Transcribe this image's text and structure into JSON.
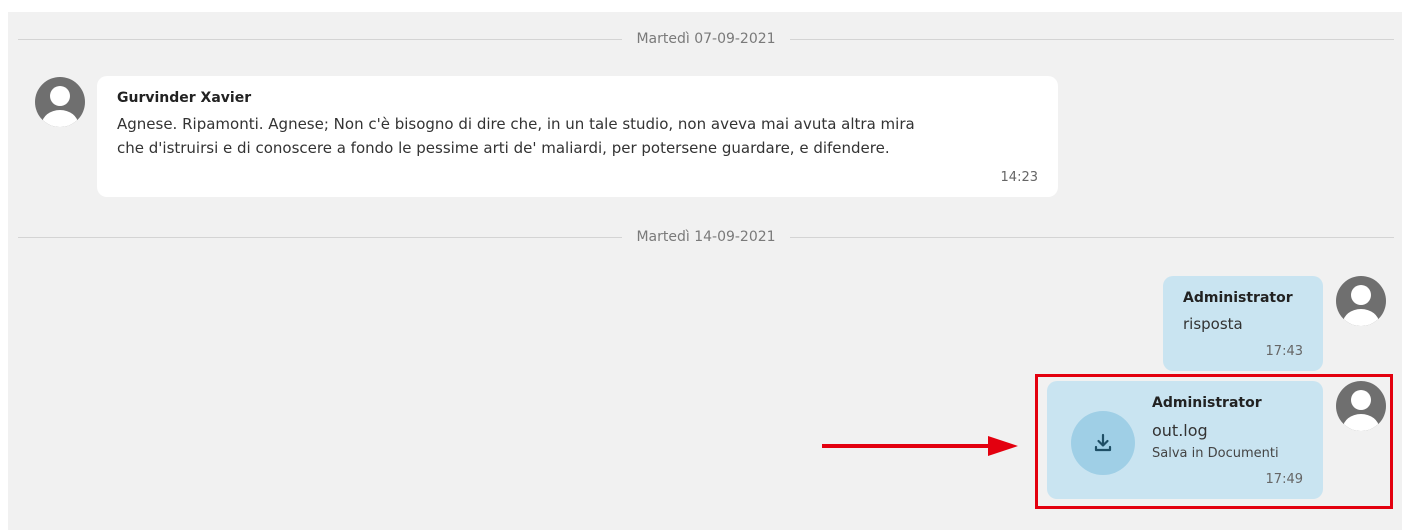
{
  "separators": [
    {
      "date": "Martedì 07-09-2021"
    },
    {
      "date": "Martedì 14-09-2021"
    }
  ],
  "messages": [
    {
      "sender": "Gurvinder Xavier",
      "text_line1": "Agnese. Ripamonti. Agnese; Non c'è bisogno di dire che, in un tale studio, non aveva mai avuta altra mira",
      "text_line2": "che d'istruirsi e di conoscere a fondo le pessime arti de' maliardi, per potersene guardare, e difendere.",
      "time": "14:23"
    },
    {
      "sender": "Administrator",
      "text": "risposta",
      "time": "17:43"
    },
    {
      "sender": "Administrator",
      "filename": "out.log",
      "save_label": "Salva in Documenti",
      "time": "17:49"
    }
  ],
  "icons": {
    "avatar": "user-avatar-icon",
    "download": "download-icon",
    "arrow": "arrow-right-annotation"
  },
  "colors": {
    "background": "#f1f1f1",
    "incoming_bubble": "#ffffff",
    "outgoing_bubble": "#c9e4f1",
    "download_circle": "#9fcfe6",
    "highlight": "#e3000f"
  }
}
